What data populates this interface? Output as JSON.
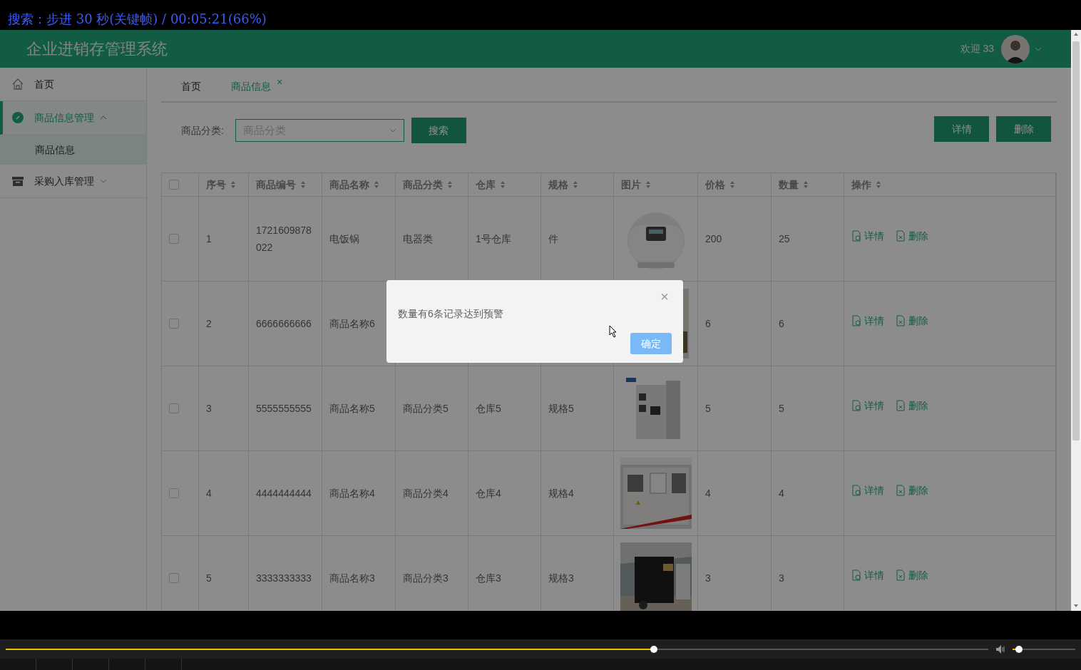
{
  "osd": {
    "text": "搜索：步进 30 秒(关键帧) / 00:05:21(66%)"
  },
  "header": {
    "title": "企业进销存管理系统",
    "welcome": "欢迎 33",
    "avatar": {
      "kind": "picture"
    }
  },
  "sidebar": {
    "items": [
      {
        "label": "首页",
        "kind": "home",
        "selected": false
      },
      {
        "label": "商品信息管理",
        "kind": "check",
        "expanded": true,
        "selected": true,
        "children": [
          {
            "label": "商品信息",
            "selected": true
          }
        ]
      },
      {
        "label": "采购入库管理",
        "kind": "box",
        "expanded": false,
        "selected": false
      }
    ]
  },
  "tabs": [
    {
      "label": "首页",
      "selected": false
    },
    {
      "label": "商品信息",
      "selected": true,
      "close": "×"
    }
  ],
  "filter": {
    "label": "商品分类:",
    "placeholder": "商品分类",
    "search": "搜索"
  },
  "toolbar": [
    "详情",
    "删除"
  ],
  "table": {
    "checked_all": false,
    "columns": [
      {
        "label": "序号"
      },
      {
        "label": "商品编号"
      },
      {
        "label": "商品名称"
      },
      {
        "label": "商品分类"
      },
      {
        "label": "仓库"
      },
      {
        "label": "规格"
      },
      {
        "label": "图片"
      },
      {
        "label": "价格"
      },
      {
        "label": "数量"
      },
      {
        "label": "操作"
      }
    ],
    "rows": [
      {
        "checked": false,
        "cells": [
          "1",
          "1721609878022",
          "电饭锅",
          "电器类",
          "1号仓库",
          "件"
        ],
        "image": {
          "kind": "picture"
        },
        "price": "200",
        "qty": "25",
        "actions": [
          "详情",
          "删除"
        ]
      },
      {
        "checked": false,
        "cells": [
          "2",
          "6666666666",
          "商品名称6"
        ],
        "image": {
          "kind": "picture"
        },
        "price": "6",
        "qty": "6",
        "actions": [
          "详情",
          "删除"
        ]
      },
      {
        "checked": false,
        "cells": [
          "3",
          "5555555555",
          "商品名称5",
          "商品分类5",
          "仓库5",
          "规格5"
        ],
        "image": {
          "kind": "picture"
        },
        "price": "5",
        "qty": "5",
        "actions": [
          "详情",
          "删除"
        ]
      },
      {
        "checked": false,
        "cells": [
          "4",
          "4444444444",
          "商品名称4",
          "商品分类4",
          "仓库4",
          "规格4"
        ],
        "image": {
          "kind": "picture"
        },
        "price": "4",
        "qty": "4",
        "actions": [
          "详情",
          "删除"
        ]
      },
      {
        "checked": false,
        "cells": [
          "5",
          "3333333333",
          "商品名称3",
          "商品分类3",
          "仓库3",
          "规格3"
        ],
        "image": {
          "kind": "picture"
        },
        "price": "3",
        "qty": "3",
        "actions": [
          "详情",
          "删除"
        ]
      }
    ]
  },
  "dialog": {
    "message": "数量有6条记录达到预警",
    "close": "×",
    "ok": "确定"
  },
  "player": {
    "seek": {
      "level": 0.66
    },
    "volume": {
      "level": 0.1
    }
  }
}
